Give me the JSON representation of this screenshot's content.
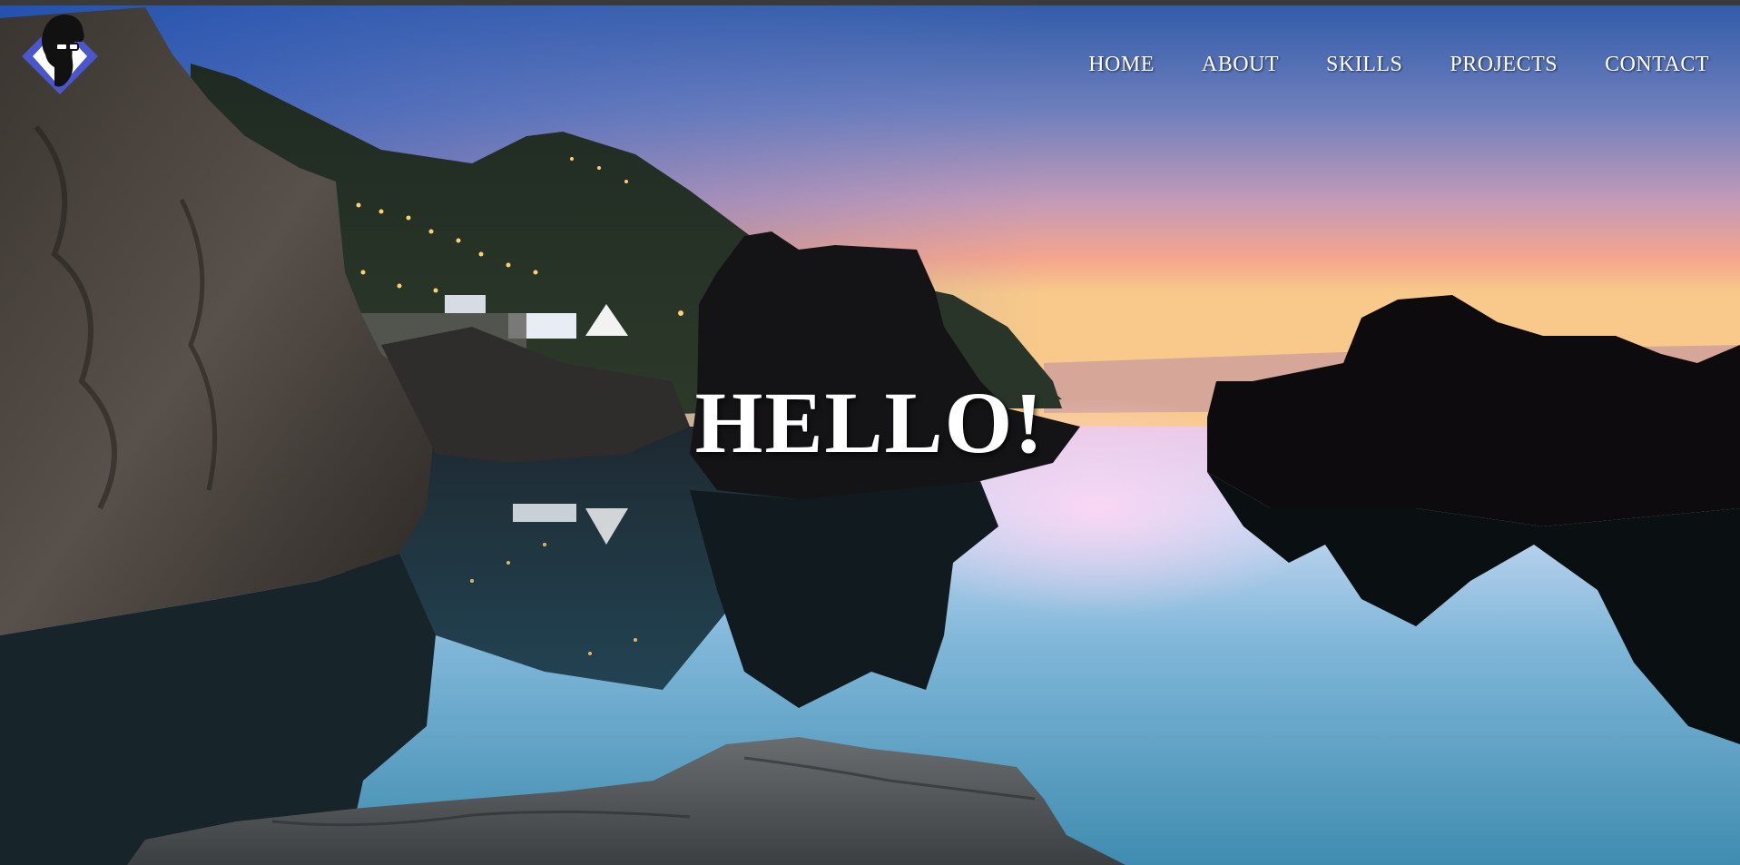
{
  "page": {
    "background_scene": "coastal-rock-pool-at-dusk",
    "logo": {
      "icon": "bearded-man-with-glasses-icon",
      "accent": "#4a56c9"
    },
    "nav": {
      "items": [
        {
          "label": "HOME"
        },
        {
          "label": "ABOUT"
        },
        {
          "label": "SKILLS"
        },
        {
          "label": "PROJECTS"
        },
        {
          "label": "CONTACT"
        }
      ]
    },
    "hero": {
      "heading": "HELLO!"
    }
  }
}
